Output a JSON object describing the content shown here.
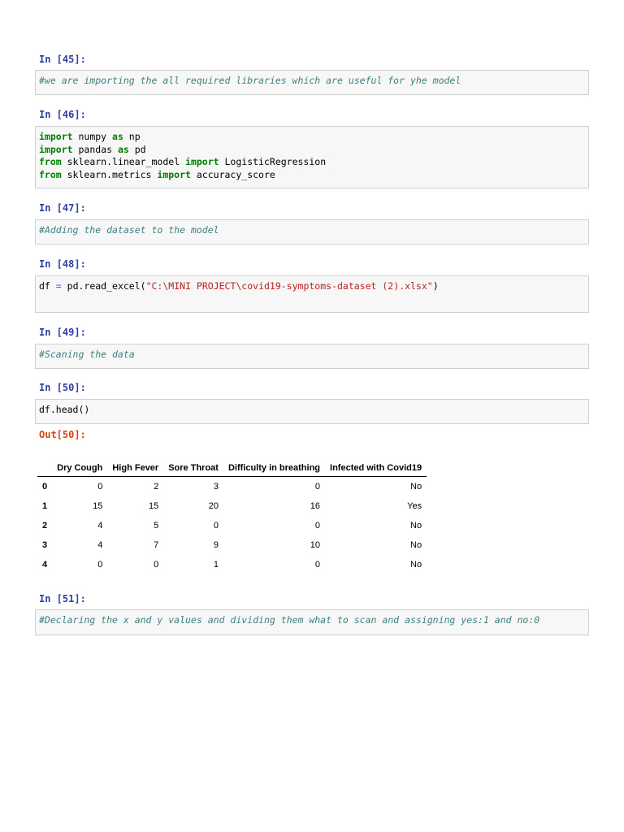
{
  "cells": [
    {
      "prompt": "In [45]:",
      "lines": [
        [
          {
            "t": "cm",
            "v": "#we are importing the all required libraries which are useful for yhe model"
          }
        ]
      ]
    },
    {
      "prompt": "In [46]:",
      "lines": [
        [
          {
            "t": "kw",
            "v": "import"
          },
          {
            "t": "",
            "v": " numpy "
          },
          {
            "t": "kw",
            "v": "as"
          },
          {
            "t": "",
            "v": " np"
          }
        ],
        [
          {
            "t": "kw",
            "v": "import"
          },
          {
            "t": "",
            "v": " pandas "
          },
          {
            "t": "kw",
            "v": "as"
          },
          {
            "t": "",
            "v": " pd"
          }
        ],
        [
          {
            "t": "kw",
            "v": "from"
          },
          {
            "t": "",
            "v": " sklearn.linear_model "
          },
          {
            "t": "kw",
            "v": "import"
          },
          {
            "t": "",
            "v": " LogisticRegression"
          }
        ],
        [
          {
            "t": "kw",
            "v": "from"
          },
          {
            "t": "",
            "v": " sklearn.metrics "
          },
          {
            "t": "kw",
            "v": "import"
          },
          {
            "t": "",
            "v": " accuracy_score"
          }
        ]
      ]
    },
    {
      "prompt": "In [47]:",
      "lines": [
        [
          {
            "t": "cm",
            "v": "#Adding the dataset to the model"
          }
        ]
      ]
    },
    {
      "prompt": "In [48]:",
      "lines": [
        [
          {
            "t": "",
            "v": "df "
          },
          {
            "t": "op",
            "v": "="
          },
          {
            "t": "",
            "v": " pd.read_excel("
          },
          {
            "t": "st",
            "v": "\"C:\\MINI PROJECT\\covid19-symptoms-dataset (2).xlsx\""
          },
          {
            "t": "",
            "v": ")"
          }
        ],
        [
          {
            "t": "",
            "v": " "
          }
        ]
      ]
    },
    {
      "prompt": "In [49]:",
      "lines": [
        [
          {
            "t": "cm",
            "v": "#Scaning the data"
          }
        ]
      ]
    },
    {
      "prompt": "In [50]:",
      "lines": [
        [
          {
            "t": "",
            "v": "df.head()"
          }
        ]
      ]
    },
    {
      "prompt": "In [51]:",
      "lines": [
        [
          {
            "t": "cm",
            "v": "#Declaring the x and y values and dividing them what to scan and assigning yes:1 and no:0"
          }
        ]
      ]
    }
  ],
  "output": {
    "prompt": "Out[50]:",
    "columns": [
      "",
      "Dry Cough",
      "High Fever",
      "Sore Throat",
      "Difficulty in breathing",
      "Infected with Covid19"
    ],
    "rows": [
      [
        "0",
        "0",
        "2",
        "3",
        "0",
        "No"
      ],
      [
        "1",
        "15",
        "15",
        "20",
        "16",
        "Yes"
      ],
      [
        "2",
        "4",
        "5",
        "0",
        "0",
        "No"
      ],
      [
        "3",
        "4",
        "7",
        "9",
        "10",
        "No"
      ],
      [
        "4",
        "0",
        "0",
        "1",
        "0",
        "No"
      ]
    ]
  }
}
